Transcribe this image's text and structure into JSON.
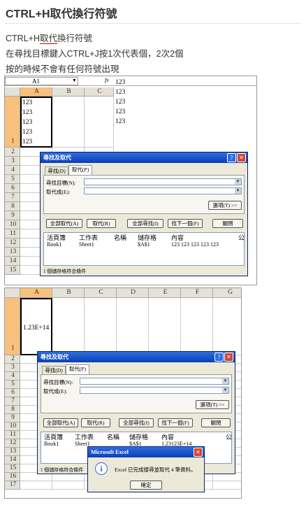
{
  "page": {
    "title": "CTRL+H取代換行符號",
    "lines": [
      "CTRL+H取代換行符號",
      "在尋找目標鍵入CTRL+J按1次代表個，2次2個",
      "按的時候不會有任何符號出現"
    ],
    "line1_plain_start": "CTRL+H",
    "line1_underlined": "取代",
    "line1_plain_end": "換行符號"
  },
  "excel1": {
    "namebox": "A1",
    "fx": "fx",
    "formula_lines": [
      "123",
      "123",
      "123",
      "123",
      "123"
    ],
    "columns": [
      "A",
      "B",
      "C"
    ],
    "cell_lines": [
      "123",
      "123",
      "123",
      "123",
      "123"
    ],
    "rows": [
      "1",
      "2",
      "3",
      "4",
      "5",
      "6",
      "7",
      "8",
      "9",
      "10",
      "11",
      "12",
      "13",
      "14",
      "15"
    ]
  },
  "dialog1": {
    "title": "尋找及取代",
    "tab_find": "尋找(D)",
    "tab_replace": "取代(P)",
    "find_label": "尋找目標(N):",
    "replace_label": "取代成(E):",
    "options_button": "選項(T) >>",
    "replace_all": "全部取代(A)",
    "replace": "取代(R)",
    "find_all": "全部尋找(I)",
    "find_next": "找下一個(F)",
    "close": "關閉",
    "result_headers": [
      "活頁簿",
      "工作表",
      "名稱",
      "儲存格",
      "內容",
      "公"
    ],
    "result_row": [
      "Book1",
      "Sheet1",
      "",
      "$A$1",
      "123 123 123 123 123"
    ],
    "status": "1 個儲存格符合條件"
  },
  "excel2": {
    "columns": [
      "A",
      "B",
      "C",
      "D",
      "E",
      "F",
      "G"
    ],
    "cell_a1": "1.23E+14",
    "rows": [
      "1",
      "2",
      "3",
      "4",
      "5",
      "6",
      "7",
      "8",
      "9",
      "10",
      "11",
      "12",
      "13",
      "14",
      "15",
      "16",
      "17"
    ]
  },
  "dialog2": {
    "title": "尋找及取代",
    "tab_find": "尋找(D)",
    "tab_replace": "取代(P)",
    "find_label": "尋找目標(N):",
    "replace_label": "取代成(E):",
    "options_button": "選項(T) >>",
    "replace_all": "全部取代(A)",
    "replace": "取代(R)",
    "find_all": "全部尋找(I)",
    "find_next": "找下一個(F)",
    "close": "關閉",
    "result_headers": [
      "活頁簿",
      "工作表",
      "名稱",
      "儲存格",
      "內容",
      "公"
    ],
    "result_row": [
      "Book1",
      "Sheet1",
      "",
      "$A$1",
      "1.23123E+14"
    ],
    "status": "1 個儲存格符合條件"
  },
  "msgbox": {
    "title": "Microsoft Excel",
    "message": "Excel 已完成搜尋並取代 4 筆資料。",
    "ok": "確定"
  },
  "colors": {
    "titlebar": "#0a3fb5",
    "dialog_bg": "#ece9d8",
    "selected_header": "#f7c07c",
    "close_red": "#d9432c"
  }
}
